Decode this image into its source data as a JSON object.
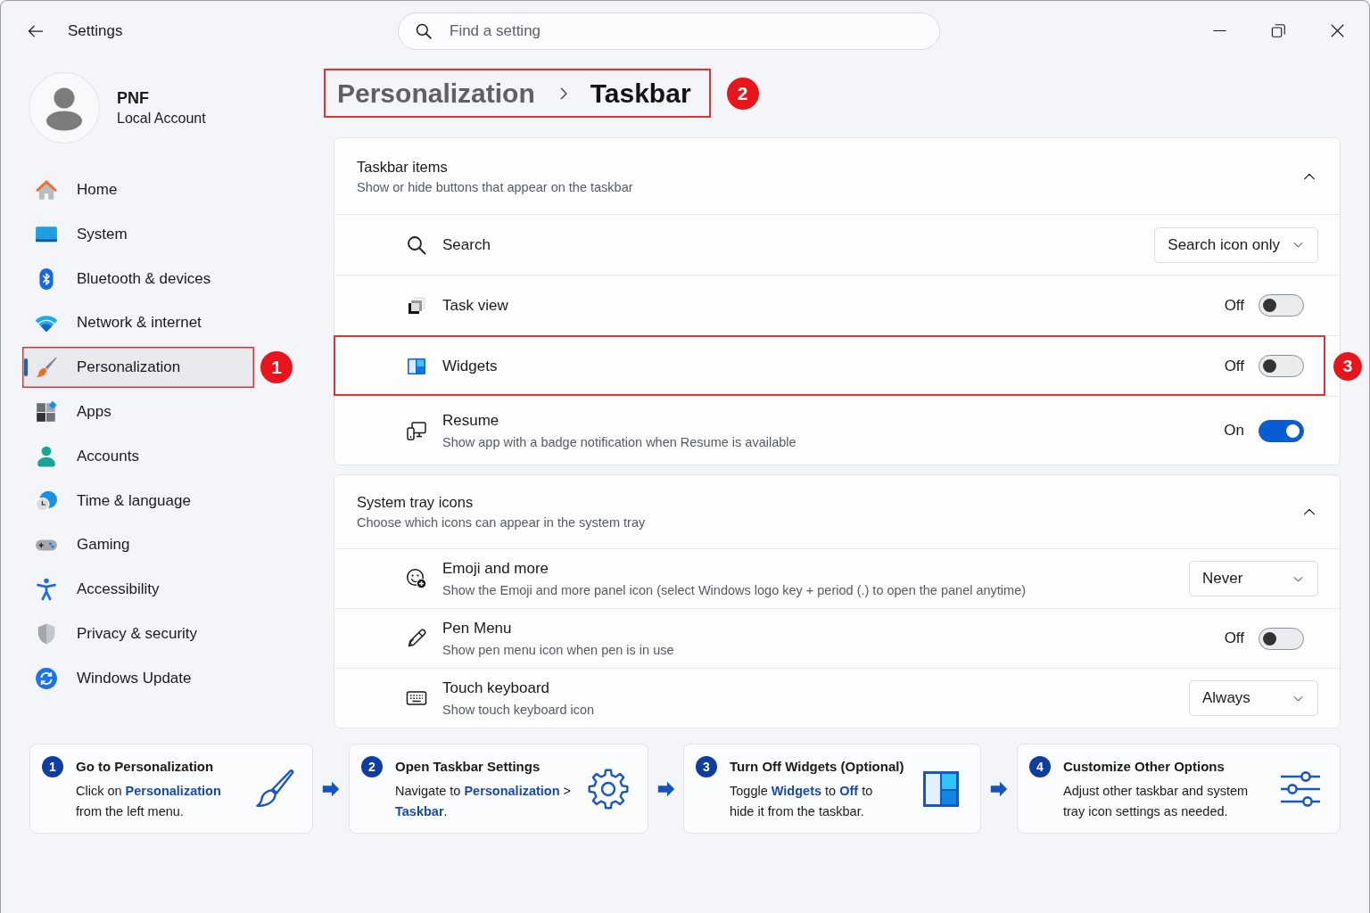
{
  "window": {
    "title": "Settings"
  },
  "search": {
    "placeholder": "Find a setting"
  },
  "account": {
    "name": "PNF",
    "type": "Local Account"
  },
  "sidebar": {
    "items": [
      {
        "label": "Home",
        "selected": false
      },
      {
        "label": "System",
        "selected": false
      },
      {
        "label": "Bluetooth & devices",
        "selected": false
      },
      {
        "label": "Network & internet",
        "selected": false
      },
      {
        "label": "Personalization",
        "selected": true,
        "callout": "1"
      },
      {
        "label": "Apps",
        "selected": false
      },
      {
        "label": "Accounts",
        "selected": false
      },
      {
        "label": "Time & language",
        "selected": false
      },
      {
        "label": "Gaming",
        "selected": false
      },
      {
        "label": "Accessibility",
        "selected": false
      },
      {
        "label": "Privacy & security",
        "selected": false
      },
      {
        "label": "Windows Update",
        "selected": false
      }
    ]
  },
  "breadcrumb": {
    "parent": "Personalization",
    "current": "Taskbar",
    "callout": "2"
  },
  "sections": [
    {
      "title": "Taskbar items",
      "description": "Show or hide buttons that appear on the taskbar",
      "expanded": true,
      "rows": [
        {
          "kind": "dropdown",
          "label": "Search",
          "value": "Search icon only"
        },
        {
          "kind": "toggle",
          "label": "Task view",
          "state_label": "Off",
          "on": false
        },
        {
          "kind": "toggle",
          "label": "Widgets",
          "state_label": "Off",
          "on": false,
          "callout": "3"
        },
        {
          "kind": "toggle",
          "label": "Resume",
          "description": "Show app with a badge notification when Resume is available",
          "state_label": "On",
          "on": true
        }
      ]
    },
    {
      "title": "System tray icons",
      "description": "Choose which icons can appear in the system tray",
      "expanded": true,
      "rows": [
        {
          "kind": "dropdown",
          "label": "Emoji and more",
          "description": "Show the Emoji and more panel icon (select Windows logo key + period (.) to open the panel anytime)",
          "value": "Never"
        },
        {
          "kind": "toggle",
          "label": "Pen Menu",
          "description": "Show pen menu icon when pen is in use",
          "state_label": "Off",
          "on": false
        },
        {
          "kind": "dropdown",
          "label": "Touch keyboard",
          "description": "Show touch keyboard icon",
          "value": "Always"
        }
      ]
    }
  ],
  "steps": [
    {
      "number": "1",
      "title": "Go to Personalization",
      "text": "Click on **Personalization** from the left menu."
    },
    {
      "number": "2",
      "title": "Open Taskbar Settings",
      "text": "Navigate to **Personalization** > **Taskbar**."
    },
    {
      "number": "3",
      "title": "Turn Off Widgets (Optional)",
      "text": "Toggle **Widgets** to **Off** to hide it from the taskbar."
    },
    {
      "number": "4",
      "title": "Customize Other Options",
      "text": "Adjust other taskbar and system tray icon settings as needed."
    }
  ]
}
